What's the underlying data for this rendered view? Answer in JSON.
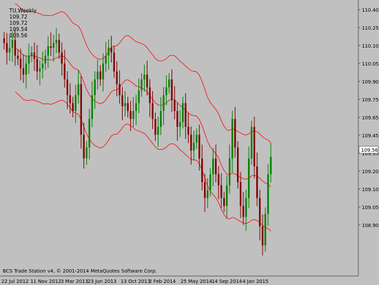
{
  "header": {
    "symbol": "TU,Weekly",
    "open": "109.72",
    "high": "109.72",
    "low": "109.54",
    "close": "109.56"
  },
  "y_axis": {
    "ticks": [
      "110.40",
      "110.25",
      "110.10",
      "110.05",
      "109.90",
      "109.75",
      "109.65",
      "109.45",
      "109.35",
      "109.20",
      "109.10",
      "109.05",
      "108.90"
    ],
    "current_price": "109.56"
  },
  "x_axis": {
    "ticks": [
      "22 Jul 2012",
      "11 Nov 2012",
      "3 Mar 2013",
      "23 Jun 2013",
      "13 Oct 2013",
      "2 Feb 2014",
      "25 May 2014",
      "14 Sep 2014",
      "4 Jan 2015"
    ]
  },
  "footer": {
    "copyright": "BCS Trade Station v4, © 2001-2014 MetaQuotes Software Corp."
  },
  "colors": {
    "background": "#c0c0c0",
    "bull_candle": "#008000",
    "bear_candle": "#800000",
    "band_line": "#ff0000",
    "price_label_bg": "#ffffff"
  },
  "chart_data": {
    "type": "candlestick",
    "ylim": [
      108.85,
      110.5
    ],
    "band_period_note": "",
    "closes": [
      110.28,
      110.22,
      110.25,
      110.3,
      110.2,
      110.18,
      110.12,
      110.08,
      110.15,
      110.2,
      110.22,
      110.18,
      110.1,
      110.12,
      110.15,
      110.2,
      110.26,
      110.25,
      110.28,
      110.3,
      110.22,
      110.15,
      110.05,
      109.95,
      109.9,
      109.85,
      109.95,
      110.02,
      109.7,
      109.55,
      109.62,
      109.8,
      109.95,
      110.05,
      110.1,
      110.05,
      110.15,
      110.2,
      110.25,
      110.22,
      110.1,
      110.02,
      109.95,
      109.88,
      109.9,
      109.85,
      109.8,
      109.85,
      109.9,
      109.98,
      110.05,
      110.08,
      110.0,
      109.9,
      109.8,
      109.7,
      109.75,
      109.85,
      109.95,
      110.0,
      110.05,
      109.92,
      109.85,
      109.75,
      109.78,
      109.9,
      109.75,
      109.7,
      109.6,
      109.65,
      109.7,
      109.55,
      109.4,
      109.3,
      109.35,
      109.45,
      109.55,
      109.45,
      109.38,
      109.3,
      109.25,
      109.38,
      109.55,
      109.8,
      109.62,
      109.4,
      109.25,
      109.18,
      109.3,
      109.55,
      109.75,
      109.5,
      109.3,
      109.12,
      109.0,
      109.2,
      109.45,
      109.56
    ]
  }
}
